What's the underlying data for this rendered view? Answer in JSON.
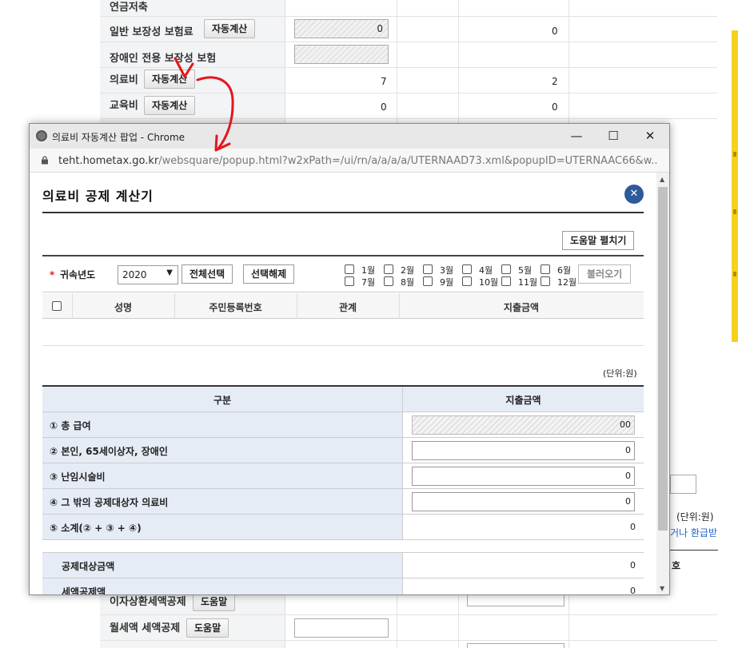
{
  "background": {
    "rows": [
      {
        "label": "연금저축",
        "button": "",
        "input_value": "",
        "col2": ""
      },
      {
        "label": "일반 보장성 보험료",
        "button": "자동계산",
        "input_value": "0",
        "col2": "0"
      },
      {
        "label": "장애인 전용 보장성 보험",
        "button": "",
        "input_value": "",
        "col2": ""
      },
      {
        "label": "의료비",
        "button": "자동계산",
        "col1": "7",
        "col2": "2"
      },
      {
        "label": "교육비",
        "button": "자동계산",
        "col1": "0",
        "col2": "0"
      },
      {
        "label": "이자상환세액공제",
        "button": "도움말"
      },
      {
        "label": "월세액 세액공제",
        "button": "도움말"
      }
    ],
    "right_unit": "(단위:원)",
    "right_text": "거나 환급받",
    "right_header": "호"
  },
  "popup": {
    "window_title": "의료비 자동계산 팝업 - Chrome",
    "url_host": "teht.hometax.go.kr",
    "url_path": "/websquare/popup.html?w2xPath=/ui/rn/a/a/a/a/UTERNAAD73.xml&popupID=UTERNAAC66&w...",
    "heading": "의료비 공제 계산기",
    "help_button": "도움말 펼치기",
    "filter": {
      "required_mark": "*",
      "year_label": "귀속년도",
      "year_value": "2020",
      "select_all": "전체선택",
      "deselect": "선택해제",
      "months_row1": [
        "1월",
        "2월",
        "3월",
        "4월",
        "5월",
        "6월"
      ],
      "months_row2": [
        "7월",
        "8월",
        "9월",
        "10월",
        "11월",
        "12월"
      ],
      "load_button": "불러오기"
    },
    "list_columns": [
      "성명",
      "주민등록번호",
      "관계",
      "지출금액"
    ],
    "unit": "(단위:원)",
    "calc": {
      "head_left": "구분",
      "head_right": "지출금액",
      "rows": [
        {
          "label": "① 총 급여",
          "value": "00"
        },
        {
          "label": "② 본인, 65세이상자, 장애인",
          "value": "0"
        },
        {
          "label": "③ 난임시술비",
          "value": "0"
        },
        {
          "label": "④ 그 밖의 공제대상자 의료비",
          "value": "0"
        },
        {
          "label": "⑤ 소계(② + ③ + ④)",
          "value": "0"
        }
      ],
      "deduction_rows": [
        {
          "label": "공제대상금액",
          "value": "0"
        },
        {
          "label": "세액공제액",
          "value": "0"
        }
      ]
    }
  }
}
